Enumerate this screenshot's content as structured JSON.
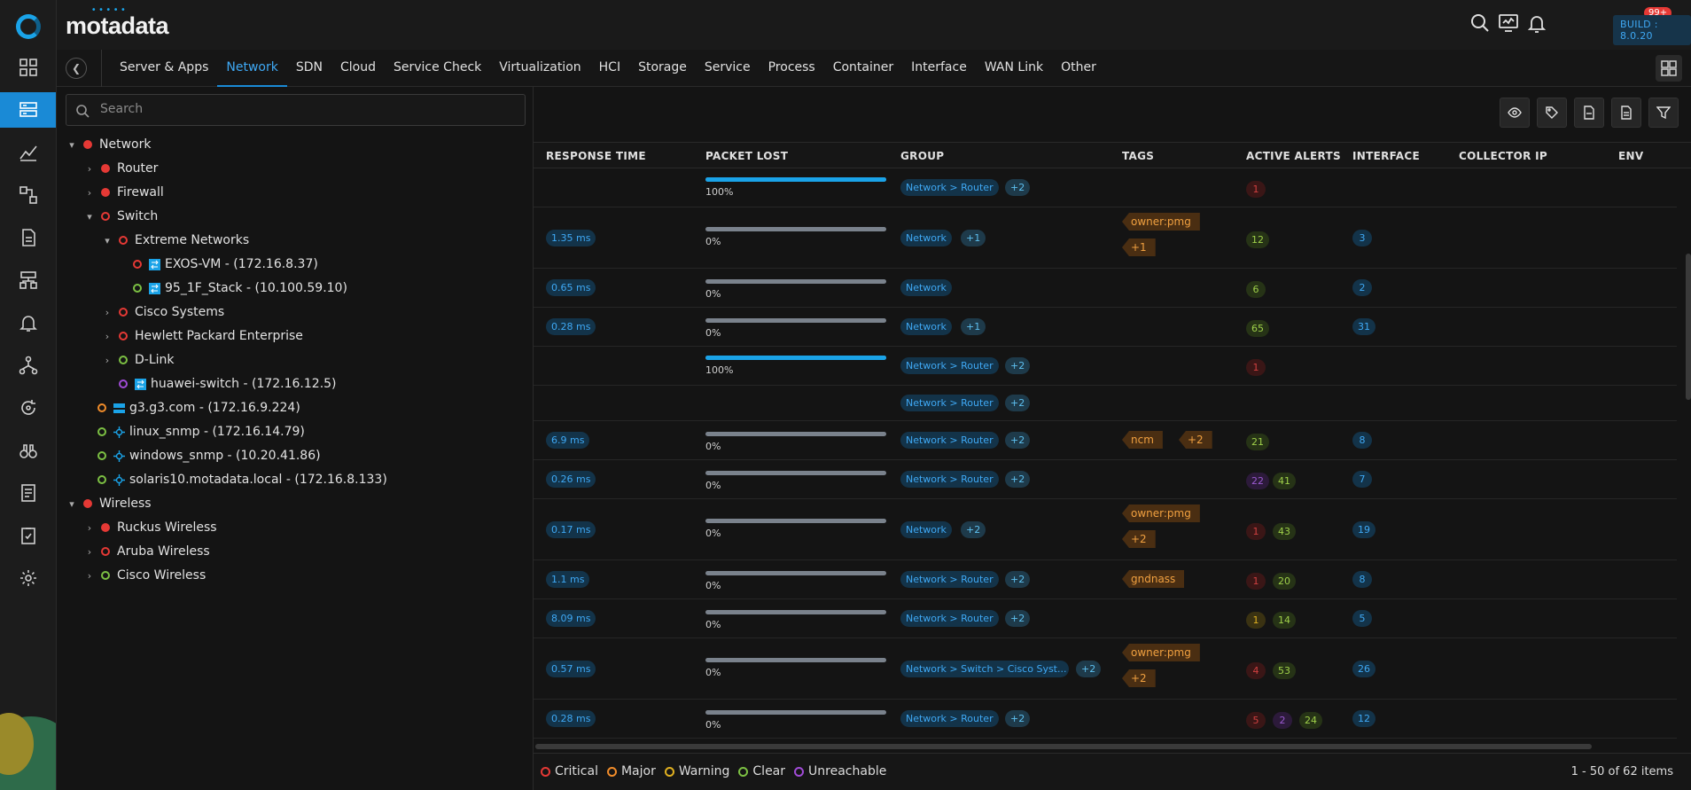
{
  "brand": {
    "name": "motadata"
  },
  "header": {
    "notifications_count": "99+",
    "build": "BUILD : 8.0.20"
  },
  "tabs": [
    "Server & Apps",
    "Network",
    "SDN",
    "Cloud",
    "Service Check",
    "Virtualization",
    "HCI",
    "Storage",
    "Service",
    "Process",
    "Container",
    "Interface",
    "WAN Link",
    "Other"
  ],
  "search": {
    "placeholder": "Search"
  },
  "tree": {
    "network": "Network",
    "router": "Router",
    "firewall": "Firewall",
    "switch": "Switch",
    "extreme": "Extreme Networks",
    "exos": "EXOS-VM - (172.16.8.37)",
    "stack": "95_1F_Stack - (10.100.59.10)",
    "cisco": "Cisco Systems",
    "hpe": "Hewlett Packard Enterprise",
    "dlink": "D-Link",
    "huawei": "huawei-switch - (172.16.12.5)",
    "g3": "g3.g3.com - (172.16.9.224)",
    "linux": "linux_snmp - (172.16.14.79)",
    "windows": "windows_snmp - (10.20.41.86)",
    "solaris": "solaris10.motadata.local - (172.16.8.133)",
    "wireless": "Wireless",
    "ruckus": "Ruckus Wireless",
    "aruba": "Aruba Wireless",
    "cisco_wireless": "Cisco Wireless"
  },
  "columns": {
    "response_time": "RESPONSE TIME",
    "packet_lost": "PACKET LOST",
    "group": "GROUP",
    "tags": "TAGS",
    "active_alerts": "ACTIVE ALERTS",
    "interface": "INTERFACE",
    "collector_ip": "COLLECTOR IP",
    "env": "ENV"
  },
  "rows": {
    "r0": {
      "pct": "100%",
      "group": "Network > Router",
      "more": "+2",
      "a1": "1"
    },
    "r1": {
      "rt": "1.35 ms",
      "pct": "0%",
      "group": "Network",
      "more": "+1",
      "tag1": "owner:pmg",
      "tag2": "+1",
      "a1": "12",
      "ifc": "3"
    },
    "r2": {
      "rt": "0.65 ms",
      "pct": "0%",
      "group": "Network",
      "a1": "6",
      "ifc": "2"
    },
    "r3": {
      "rt": "0.28 ms",
      "pct": "0%",
      "group": "Network",
      "more": "+1",
      "a1": "65",
      "ifc": "31"
    },
    "r4": {
      "pct": "100%",
      "group": "Network > Router",
      "more": "+2",
      "a1": "1"
    },
    "r5": {
      "group": "Network > Router",
      "more": "+2"
    },
    "r6": {
      "rt": "6.9 ms",
      "pct": "0%",
      "group": "Network > Router",
      "more": "+2",
      "tag1": "ncm",
      "tag2": "+2",
      "a1": "21",
      "ifc": "8"
    },
    "r7": {
      "rt": "0.26 ms",
      "pct": "0%",
      "group": "Network > Router",
      "more": "+2",
      "a1": "22",
      "a2": "41",
      "ifc": "7"
    },
    "r8": {
      "rt": "0.17 ms",
      "pct": "0%",
      "group": "Network",
      "more": "+2",
      "tag1": "owner:pmg",
      "tag2": "+2",
      "a1": "1",
      "a2": "43",
      "ifc": "19"
    },
    "r9": {
      "rt": "1.1 ms",
      "pct": "0%",
      "group": "Network > Router",
      "more": "+2",
      "tag1": "gndnass",
      "a1": "1",
      "a2": "20",
      "ifc": "8"
    },
    "r10": {
      "rt": "8.09 ms",
      "pct": "0%",
      "group": "Network > Router",
      "more": "+2",
      "a1": "1",
      "a2": "14",
      "ifc": "5"
    },
    "r11": {
      "rt": "0.57 ms",
      "pct": "0%",
      "group": "Network > Switch > Cisco Syst...",
      "more": "+2",
      "tag1": "owner:pmg",
      "tag2": "+2",
      "a1": "4",
      "a2": "53",
      "ifc": "26"
    },
    "r12": {
      "rt": "0.28 ms",
      "pct": "0%",
      "group": "Network > Router",
      "more": "+2",
      "a1": "5",
      "a2": "2",
      "a3": "24",
      "ifc": "12"
    }
  },
  "legend": [
    "Critical",
    "Major",
    "Warning",
    "Clear",
    "Unreachable"
  ],
  "pager": "1 - 50 of 62 items",
  "colors": {
    "accent": "#1a8ad6",
    "critical": "#e53935",
    "major": "#f08c2a",
    "warning": "#e0b020",
    "clear": "#7cc043",
    "unreachable": "#a04bd6"
  }
}
